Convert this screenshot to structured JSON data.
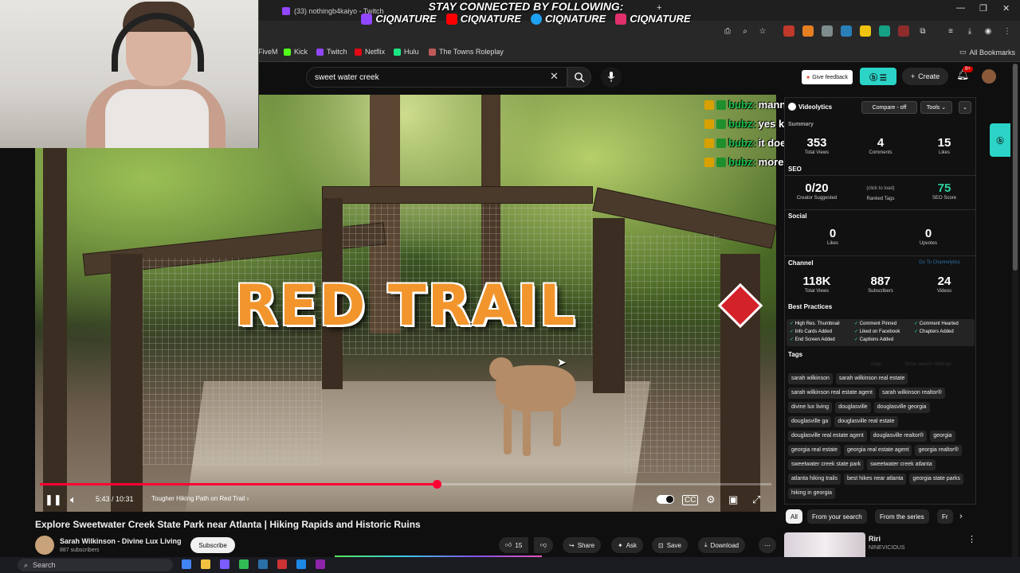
{
  "browser": {
    "tabs": [
      {
        "label": "(33) nothingb4kaiyo - Twitch"
      }
    ],
    "bookmarks": [
      {
        "label": "FiveM",
        "color": "#444444"
      },
      {
        "label": "Kick",
        "color": "#53fc18"
      },
      {
        "label": "Twitch",
        "color": "#9146ff"
      },
      {
        "label": "Netflix",
        "color": "#e50914"
      },
      {
        "label": "Hulu",
        "color": "#1ce783"
      },
      {
        "label": "The Towns Roleplay",
        "color": "#c05a5a"
      }
    ],
    "all_bookmarks": "All Bookmarks"
  },
  "overlay": {
    "banner": "STAY CONNECTED BY FOLLOWING:",
    "socials": [
      {
        "platform": "twitch-icon",
        "handle": "CIQNATURE",
        "color": "#9146ff"
      },
      {
        "platform": "youtube-icon",
        "handle": "CIQNATURE",
        "color": "#ff0000"
      },
      {
        "platform": "twitter-icon",
        "handle": "CIQNATURE",
        "color": "#1da1f2"
      },
      {
        "platform": "instagram-icon",
        "handle": "CIQNATURE",
        "color": "#e1306c"
      }
    ]
  },
  "youtube": {
    "search_value": "sweet water creek",
    "give_feedback": "Give feedback",
    "create": "Create",
    "notif_count": "9+"
  },
  "video": {
    "overlay_text": "RED TRAIL",
    "time": "5:43 / 10:31",
    "chapter": "Tougher Hiking Path on Red Trail",
    "progress": 0.543,
    "title": "Explore Sweetwater Creek State Park near Atlanta | Hiking Rapids and Historic Ruins",
    "channel": "Sarah Wilkinson - Divine Lux Living",
    "subscribers": "887 subscribers",
    "subscribe": "Subscribe",
    "likes": "15",
    "share": "Share",
    "ask": "Ask",
    "save": "Save",
    "download": "Download"
  },
  "chat": [
    {
      "user": "bubz:",
      "message": "manno omgg"
    },
    {
      "user": "bubz:",
      "message": "yes keep it preserved"
    },
    {
      "user": "bubz:",
      "message": "it does"
    },
    {
      "user": "bubz:",
      "message": "more grassy"
    }
  ],
  "panel": {
    "title": "Videolytics",
    "compare": "Compare - off",
    "tools": "Tools",
    "summary": "Summary",
    "summary_stats": [
      {
        "value": "353",
        "label": "Total Views"
      },
      {
        "value": "4",
        "label": "Comments"
      },
      {
        "value": "15",
        "label": "Likes"
      }
    ],
    "seo": "SEO",
    "seo_stats": [
      {
        "value": "0/20",
        "label": "Creator Suggested"
      },
      {
        "value": "(click to load)",
        "label": "Ranked Tags"
      },
      {
        "value": "75",
        "label": "SEO Score"
      }
    ],
    "social": "Social",
    "social_stats": [
      {
        "value": "0",
        "label": "Likes"
      },
      {
        "value": "0",
        "label": "Upvotes"
      }
    ],
    "channel": "Channel",
    "go_to_channel": "Go To Channelytics",
    "channel_stats": [
      {
        "value": "118K",
        "label": "Total Views"
      },
      {
        "value": "887",
        "label": "Subscribers"
      },
      {
        "value": "24",
        "label": "Videos"
      }
    ],
    "best_practices": "Best Practices",
    "bp_items": [
      "High Res. Thumbnail",
      "Info Cards Added",
      "End Screen Added",
      "Comment Pinned",
      "Liked on Facebook",
      "Captions Added",
      "Comment Hearted",
      "Chapters Added"
    ],
    "tags_title": "Tags",
    "tags_copy": "copy",
    "tags_show": "Show search rankings",
    "tags": [
      "sarah wilkinson",
      "sarah wilkinson real estate",
      "sarah wilkinson real estate agent",
      "sarah wilkinson realtor®",
      "divine lux living",
      "douglasville",
      "douglasville georgia",
      "douglasville ga",
      "douglasville real estate",
      "douglasville real estate agent",
      "douglasville realtor®",
      "georgia",
      "georgia real estate",
      "georgia real estate agent",
      "georgia realtor®",
      "sweetwater creek state park",
      "sweetwater creek atlanta",
      "atlanta hiking trails",
      "best hikes near atlanta",
      "georgia state parks",
      "hiking in georgia"
    ]
  },
  "chips": [
    "All",
    "From your search",
    "From the series",
    "Fr"
  ],
  "recommendation": {
    "title": "Riri",
    "channel": "NINEVICIOUS"
  },
  "taskbar": {
    "search": "Search"
  }
}
